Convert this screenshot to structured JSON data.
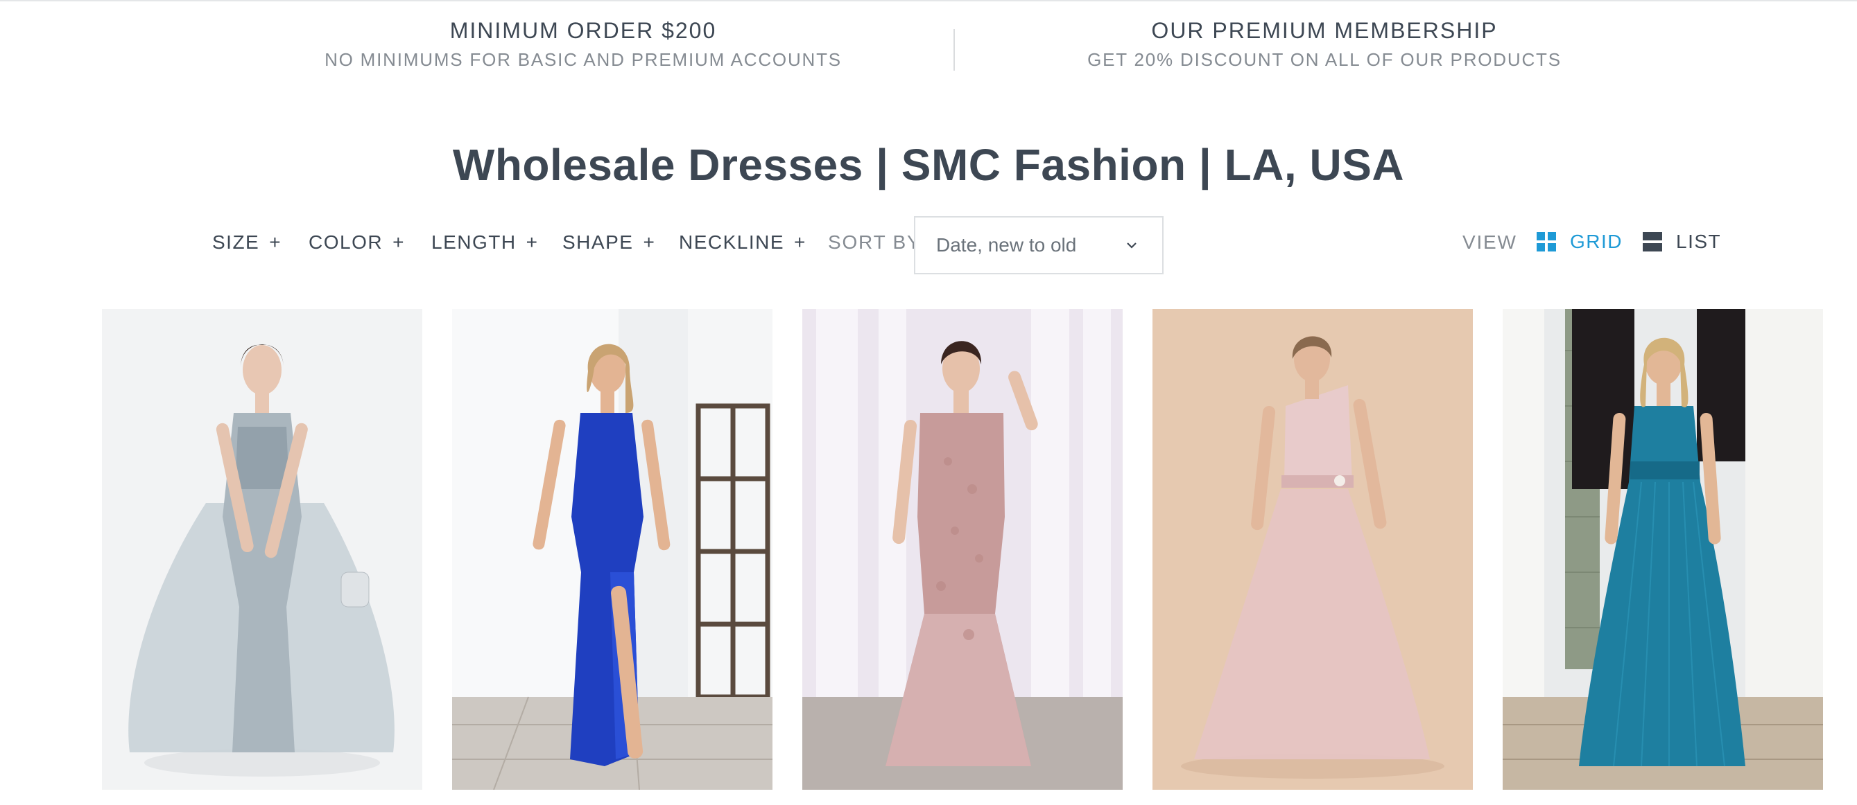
{
  "promo": {
    "left": {
      "title": "MINIMUM ORDER $200",
      "subtitle": "NO MINIMUMS FOR BASIC AND PREMIUM ACCOUNTS"
    },
    "right": {
      "title": "OUR PREMIUM MEMBERSHIP",
      "subtitle": "GET 20% DISCOUNT ON ALL OF OUR PRODUCTS"
    }
  },
  "page": {
    "title": "Wholesale Dresses | SMC Fashion | LA, USA"
  },
  "filters": [
    {
      "label": "SIZE",
      "icon": "plus"
    },
    {
      "label": "COLOR",
      "icon": "plus"
    },
    {
      "label": "LENGTH",
      "icon": "plus"
    },
    {
      "label": "SHAPE",
      "icon": "plus"
    },
    {
      "label": "NECKLINE",
      "icon": "plus"
    }
  ],
  "sort": {
    "label": "SORT BY",
    "selected": "Date, new to old",
    "icon": "chevron-down-icon"
  },
  "view": {
    "label": "VIEW",
    "options": [
      {
        "label": "GRID",
        "icon": "grid-icon",
        "active": true
      },
      {
        "label": "LIST",
        "icon": "list-icon",
        "active": false
      }
    ]
  },
  "colors": {
    "text": "#3d4753",
    "muted": "#858b92",
    "accent": "#1e9ad6",
    "border": "#dcdfe2"
  },
  "products": [
    {
      "image": "Silver grey sequined gown with sheer tulle overskirt",
      "bg": "#f2f3f4",
      "dress": "#aab6be"
    },
    {
      "image": "Royal blue sequined gown with high leg slit",
      "bg": "#e6e8ea",
      "dress": "#1f3fc0"
    },
    {
      "image": "Dusty pink lace off-shoulder mermaid gown",
      "bg": "#ece6ef",
      "dress": "#c79b9a"
    },
    {
      "image": "Blush pink one-shoulder chiffon gown",
      "bg": "#e6c9b0",
      "dress": "#e5c4c4"
    },
    {
      "image": "Teal pleated metallic V-neck gown",
      "bg": "#6b6a62",
      "dress": "#1e7fa0"
    }
  ]
}
